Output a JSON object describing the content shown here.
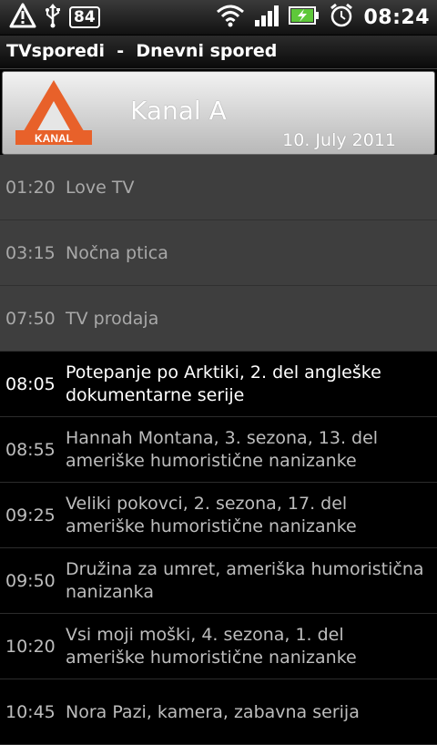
{
  "status_bar": {
    "battery_level_text": "84",
    "clock": "08:24",
    "icons": [
      "warning-icon",
      "usb-icon",
      "wifi-icon",
      "signal-icon",
      "battery-charging-icon",
      "alarm-icon"
    ]
  },
  "app": {
    "title": "TVsporedi  -  Dnevni spored"
  },
  "channel": {
    "name": "Kanal A",
    "date": "10. July 2011",
    "logo_text": "KANAL",
    "accent": "#e8612a"
  },
  "programmes": [
    {
      "time": "01:20",
      "title": "Love TV",
      "state": "past"
    },
    {
      "time": "03:15",
      "title": "Nočna ptica",
      "state": "past"
    },
    {
      "time": "07:50",
      "title": "TV prodaja",
      "state": "past"
    },
    {
      "time": "08:05",
      "title": "Potepanje po Arktiki, 2. del angleške dokumentarne serije",
      "state": "current"
    },
    {
      "time": "08:55",
      "title": "Hannah Montana, 3. sezona, 13. del ameriške humoristične nanizanke",
      "state": "upcoming"
    },
    {
      "time": "09:25",
      "title": "Veliki pokovci, 2. sezona, 17. del ameriške humoristične nanizanke",
      "state": "upcoming"
    },
    {
      "time": "09:50",
      "title": "Družina za umret, ameriška humoristična nanizanka",
      "state": "upcoming"
    },
    {
      "time": "10:20",
      "title": "Vsi moji moški, 4. sezona, 1. del ameriške humoristične nanizanke",
      "state": "upcoming"
    },
    {
      "time": "10:45",
      "title": "Nora Pazi, kamera, zabavna serija",
      "state": "upcoming"
    }
  ]
}
